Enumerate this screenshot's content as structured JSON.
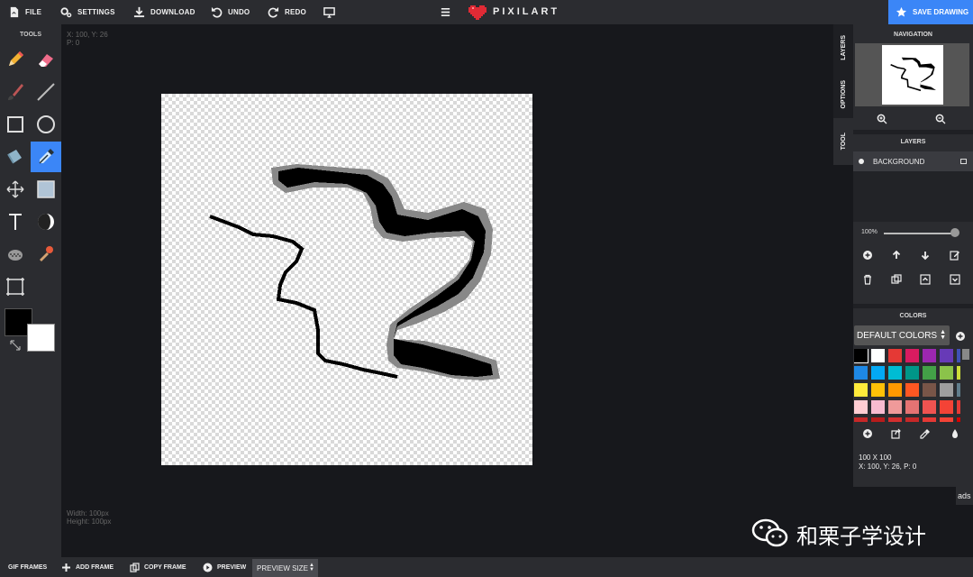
{
  "topbar": {
    "file": "FILE",
    "settings": "SETTINGS",
    "download": "DOWNLOAD",
    "undo": "UNDO",
    "redo": "REDO",
    "logo": "PIXILART",
    "save": "SAVE DRAWING"
  },
  "tools": {
    "title": "TOOLS",
    "items": [
      "pencil",
      "eraser",
      "brush",
      "line",
      "rectangle",
      "circle",
      "bucket",
      "eyedropper",
      "move",
      "select-fill",
      "text",
      "shade",
      "dither",
      "stamp",
      "crop"
    ],
    "active": "eyedropper",
    "primary_color": "#000000",
    "secondary_color": "#ffffff"
  },
  "workspace": {
    "cursor": "X: 100, Y: 26",
    "pressure": "P: 0",
    "width": "Width: 100px",
    "height": "Height: 100px"
  },
  "side_tabs": [
    "LAYERS",
    "OPTIONS",
    "TOOL"
  ],
  "panel": {
    "navigation_title": "NAVIGATION",
    "layers_title": "LAYERS",
    "layer_name": "BACKGROUND",
    "opacity": "100%",
    "colors_title": "COLORS",
    "palette": "DEFAULT COLORS",
    "swatches": [
      "#000000",
      "#ffffff",
      "#e53935",
      "#d81b60",
      "#9c27b0",
      "#673ab7",
      "#3f51b5",
      "#1e88e5",
      "#03a9f4",
      "#00bcd4",
      "#009688",
      "#43a047",
      "#8bc34a",
      "#cddc39",
      "#ffeb3b",
      "#ffc107",
      "#ff9800",
      "#ff5722",
      "#795548",
      "#9e9e9e",
      "#607d8b",
      "#ffcdd2",
      "#f8bbd0",
      "#ef9a9a",
      "#e57373",
      "#ef5350",
      "#f44336",
      "#e53935",
      "#c62828",
      "#b71c1c",
      "#d32f2f",
      "#c62828",
      "#e53935",
      "#f44336",
      "#d50000"
    ],
    "canvas_size": "100 X 100",
    "cursor_info": "X: 100, Y: 26, P: 0"
  },
  "ads": "ads",
  "bottombar": {
    "gif_frames": "GIF FRAMES",
    "add_frame": "ADD FRAME",
    "copy_frame": "COPY FRAME",
    "preview": "PREVIEW",
    "preview_size": "PREVIEW SIZE"
  },
  "watermark": "和栗子学设计",
  "colors": {
    "accent": "#3b86f7",
    "panel": "#2b2c30",
    "workspace": "#17181c"
  }
}
